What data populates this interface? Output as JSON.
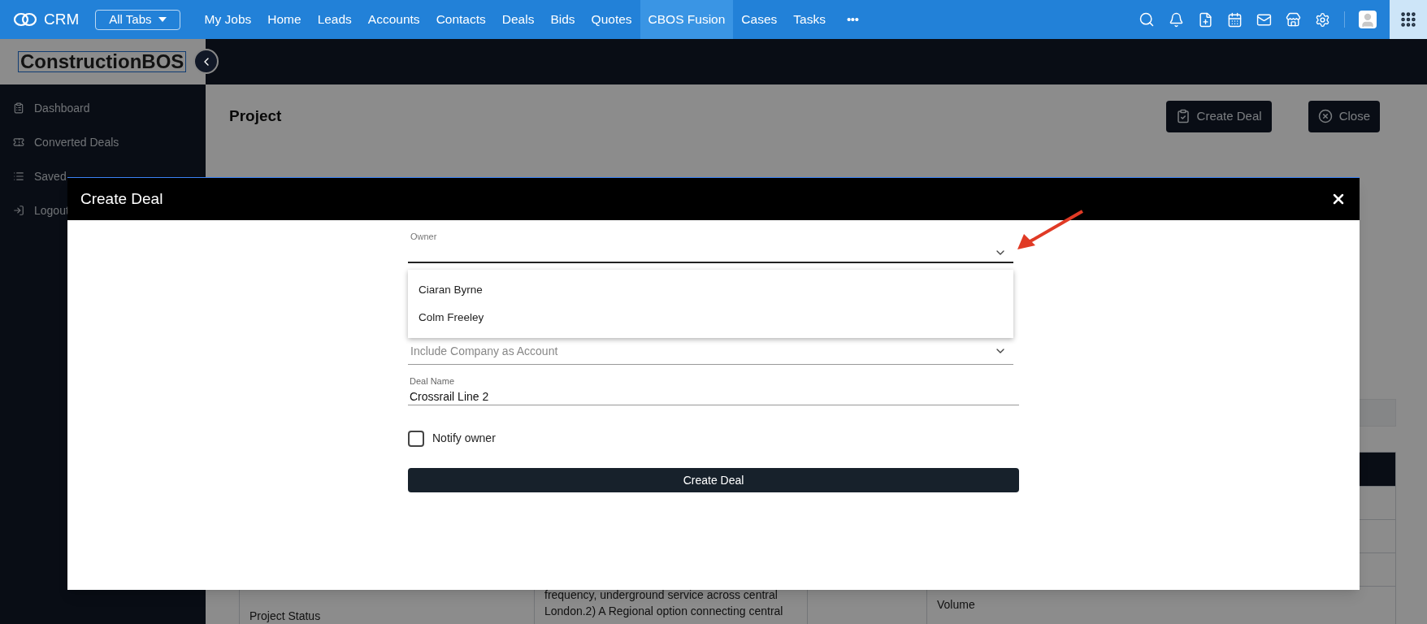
{
  "top_nav": {
    "brand": "CRM",
    "all_tabs": "All Tabs",
    "more": "•••",
    "tabs": [
      {
        "label": "My Jobs",
        "selected": false
      },
      {
        "label": "Home",
        "selected": false
      },
      {
        "label": "Leads",
        "selected": false
      },
      {
        "label": "Accounts",
        "selected": false
      },
      {
        "label": "Contacts",
        "selected": false
      },
      {
        "label": "Deals",
        "selected": false
      },
      {
        "label": "Bids",
        "selected": false
      },
      {
        "label": "Quotes",
        "selected": false
      },
      {
        "label": "CBOS Fusion",
        "selected": true
      },
      {
        "label": "Cases",
        "selected": false
      },
      {
        "label": "Tasks",
        "selected": false
      }
    ]
  },
  "sidebar": {
    "logo": "ConstructionBOS",
    "items": [
      {
        "label": "Dashboard",
        "kind": "dashboard"
      },
      {
        "label": "Converted Deals",
        "kind": "deals"
      },
      {
        "label": "Saved",
        "kind": "searches"
      },
      {
        "label": "Logout",
        "kind": "logout"
      }
    ]
  },
  "page": {
    "title": "Project",
    "buttons": [
      {
        "label": "Create Deal",
        "kind": "create"
      },
      {
        "label": "Close",
        "kind": "close"
      }
    ]
  },
  "table": {
    "rows": [
      {
        "label": "Project Status",
        "description": [
          "frequency, underground service across central",
          "London.2) A Regional option connecting central"
        ],
        "column_4": "Volume"
      }
    ]
  },
  "modal": {
    "title": "Create Deal",
    "owner": {
      "label": "Owner",
      "expanded": true,
      "options": [
        {
          "label": "Ciaran Byrne",
          "selected": false
        },
        {
          "label": "Colm Freeley",
          "selected": false
        }
      ]
    },
    "account_select": {
      "placeholder": "Include Company as Account"
    },
    "deal_name": {
      "label": "Deal Name",
      "value": "Crossrail Line 2"
    },
    "notify": {
      "label": "Notify owner",
      "checked": false
    },
    "submit": "Create Deal"
  }
}
